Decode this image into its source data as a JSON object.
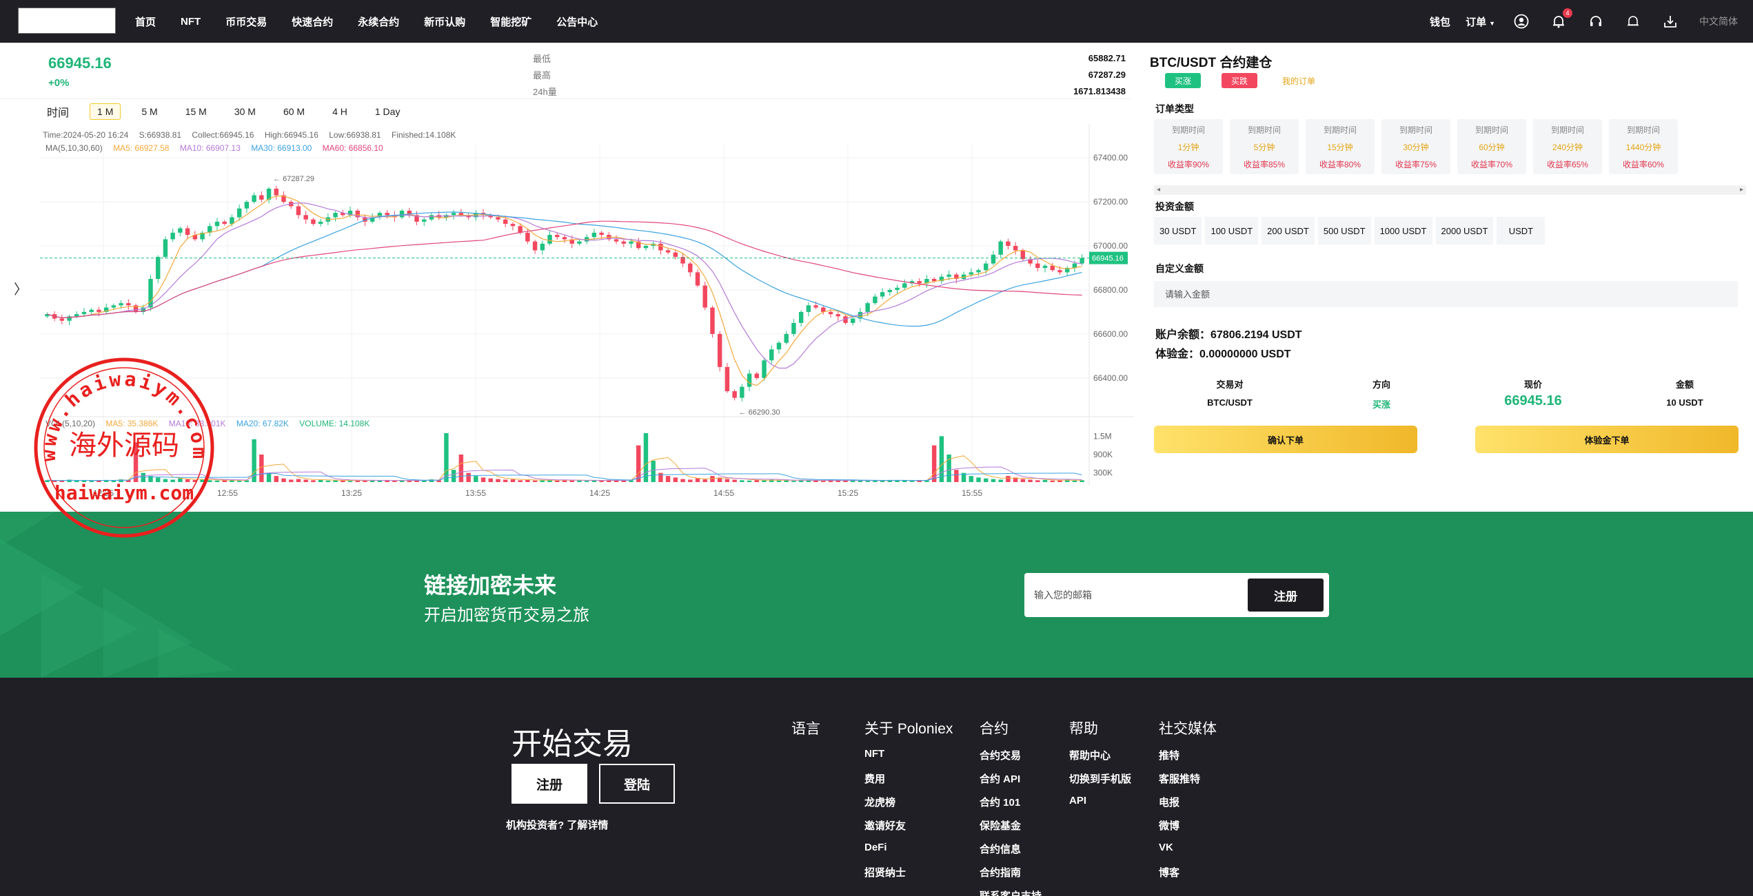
{
  "nav": {
    "links": [
      "首页",
      "NFT",
      "币币交易",
      "快速合约",
      "永续合约",
      "新币认购",
      "智能挖矿",
      "公告中心"
    ],
    "wallet": "钱包",
    "orders": "订单",
    "notification_count": "4",
    "language": "中文简体",
    "icons": [
      "user-icon",
      "bell-icon",
      "headset-icon",
      "bell-outline-icon",
      "download-icon"
    ]
  },
  "price_header": {
    "price": "66945.16",
    "change": "+0%",
    "stats": [
      {
        "label": "最低",
        "value": "65882.71"
      },
      {
        "label": "最高",
        "value": "67287.29"
      },
      {
        "label": "24h量",
        "value": "1671.813438"
      }
    ]
  },
  "periods": {
    "label": "时间",
    "items": [
      "1 M",
      "5 M",
      "15 M",
      "30 M",
      "60 M",
      "4 H",
      "1 Day"
    ],
    "active": "1 M"
  },
  "chart_data": {
    "type": "candlestick",
    "info_line": {
      "time": "Time:2024-05-20 16:24",
      "open": "S:66938.81",
      "collect": "Collect:66945.16",
      "high": "High:66945.16",
      "low": "Low:66938.81",
      "finished": "Finished:14.108K"
    },
    "ma_legend": {
      "label": "MA(5,10,30,60)",
      "ma5": "MA5: 66927.58",
      "ma10": "MA10: 66907.13",
      "ma30": "MA30: 66913.00",
      "ma60": "MA60: 66856.10"
    },
    "vol_legend": {
      "label": "VOL(5,10,20)",
      "ma5": "MA5: 35.386K",
      "ma10": "MA10: 33.901K",
      "ma20": "MA20: 67.82K",
      "volume": "VOLUME: 14.108K"
    },
    "y_ticks": [
      "67400.00",
      "67200.00",
      "67000.00",
      "66800.00",
      "66600.00",
      "66400.00"
    ],
    "y_tick_values": [
      67400,
      67200,
      67000,
      66800,
      66600,
      66400
    ],
    "vol_ticks": [
      "1.5M",
      "900K",
      "300K"
    ],
    "vol_tick_values": [
      1500000,
      900000,
      300000
    ],
    "x_ticks": [
      "12:25",
      "12:55",
      "13:25",
      "13:55",
      "14:25",
      "14:55",
      "15:25",
      "15:55"
    ],
    "current_price": "66945.16",
    "current_price_value": 66945.16,
    "max_label": "67287.29",
    "max_value": 67287.29,
    "min_label": "66290.30",
    "min_value": 66290.3,
    "closes": [
      66690,
      66670,
      66660,
      66680,
      66690,
      66700,
      66710,
      66700,
      66720,
      66730,
      66740,
      66730,
      66700,
      66720,
      66850,
      66950,
      67030,
      67060,
      67080,
      67050,
      67030,
      67060,
      67090,
      67110,
      67100,
      67130,
      67170,
      67200,
      67230,
      67210,
      67260,
      67230,
      67200,
      67180,
      67140,
      67120,
      67100,
      67110,
      67130,
      67150,
      67140,
      67160,
      67130,
      67110,
      67130,
      67150,
      67140,
      67130,
      67160,
      67140,
      67110,
      67120,
      67140,
      67130,
      67140,
      67150,
      67140,
      67130,
      67150,
      67140,
      67130,
      67120,
      67100,
      67090,
      67060,
      67020,
      66980,
      67010,
      67050,
      67040,
      67030,
      67010,
      67020,
      67040,
      67060,
      67050,
      67030,
      67020,
      67010,
      67020,
      66990,
      67000,
      67010,
      66980,
      66970,
      66950,
      66920,
      66880,
      66820,
      66720,
      66600,
      66450,
      66340,
      66310,
      66360,
      66420,
      66400,
      66480,
      66530,
      66560,
      66600,
      66650,
      66700,
      66730,
      66720,
      66700,
      66690,
      66680,
      66650,
      66670,
      66700,
      66740,
      66770,
      66790,
      66800,
      66810,
      66830,
      66840,
      66830,
      66850,
      66840,
      66860,
      66870,
      66850,
      66870,
      66880,
      66890,
      66920,
      66960,
      67020,
      67000,
      66980,
      66940,
      66920,
      66900,
      66910,
      66890,
      66880,
      66900,
      66920,
      66945
    ],
    "volumes": [
      60000,
      50000,
      40000,
      80000,
      50000,
      60000,
      40000,
      50000,
      70000,
      60000,
      90000,
      70000,
      1300000,
      300000,
      200000,
      150000,
      100000,
      80000,
      120000,
      90000,
      70000,
      80000,
      60000,
      50000,
      70000,
      60000,
      40000,
      60000,
      1400000,
      900000,
      300000,
      200000,
      120000,
      80000,
      100000,
      80000,
      60000,
      70000,
      50000,
      60000,
      50000,
      40000,
      60000,
      50000,
      70000,
      60000,
      50000,
      40000,
      60000,
      50000,
      70000,
      60000,
      90000,
      60000,
      1600000,
      400000,
      900000,
      300000,
      200000,
      150000,
      120000,
      100000,
      80000,
      90000,
      60000,
      70000,
      50000,
      60000,
      70000,
      50000,
      80000,
      60000,
      50000,
      40000,
      60000,
      50000,
      70000,
      60000,
      50000,
      60000,
      1200000,
      1600000,
      700000,
      300000,
      200000,
      150000,
      100000,
      80000,
      120000,
      90000,
      200000,
      150000,
      100000,
      80000,
      60000,
      50000,
      70000,
      60000,
      80000,
      50000,
      60000,
      40000,
      70000,
      60000,
      50000,
      40000,
      60000,
      50000,
      70000,
      60000,
      50000,
      40000,
      60000,
      50000,
      70000,
      60000,
      50000,
      40000,
      60000,
      50000,
      1200000,
      1500000,
      900000,
      400000,
      300000,
      200000,
      150000,
      120000,
      100000,
      80000,
      200000,
      150000,
      100000,
      80000,
      60000,
      70000,
      50000,
      60000,
      80000,
      50000,
      60000
    ]
  },
  "trade_panel": {
    "title": "BTC/USDT 合约建仓",
    "tabs": {
      "buy": "买涨",
      "sell": "买跌",
      "orders": "我的订单"
    },
    "order_type_label": "订单类型",
    "periods": [
      {
        "a": "到期时间",
        "b": "1分钟",
        "c": "收益率90%"
      },
      {
        "a": "到期时间",
        "b": "5分钟",
        "c": "收益率85%"
      },
      {
        "a": "到期时间",
        "b": "15分钟",
        "c": "收益率80%"
      },
      {
        "a": "到期时间",
        "b": "30分钟",
        "c": "收益率75%"
      },
      {
        "a": "到期时间",
        "b": "60分钟",
        "c": "收益率70%"
      },
      {
        "a": "到期时间",
        "b": "240分钟",
        "c": "收益率65%"
      },
      {
        "a": "到期时间",
        "b": "1440分钟",
        "c": "收益率60%"
      }
    ],
    "amount_label": "投资金额",
    "amounts": [
      "30 USDT",
      "100 USDT",
      "200 USDT",
      "500 USDT",
      "1000 USDT",
      "2000 USDT",
      "USDT"
    ],
    "custom_label": "自定义金额",
    "custom_placeholder": "请输入金额",
    "balance": "账户余额：67806.2194 USDT",
    "trial": "体验金：0.00000000 USDT",
    "summary": {
      "headers": [
        "交易对",
        "方向",
        "现价",
        "金额"
      ],
      "pair": "BTC/USDT",
      "direction": "买涨",
      "price": "66945.16",
      "amount": "10 USDT"
    },
    "confirm": "确认下单",
    "trial_order": "体验金下单"
  },
  "banner": {
    "title": "链接加密未来",
    "subtitle": "开启加密货币交易之旅",
    "email_placeholder": "输入您的邮箱",
    "register": "注册"
  },
  "footer": {
    "start": "开始交易",
    "register": "注册",
    "login": "登陆",
    "institutional": "机构投资者? 了解详情",
    "columns": [
      {
        "title": "语言",
        "items": []
      },
      {
        "title": "关于 Poloniex",
        "items": [
          "NFT",
          "费用",
          "龙虎榜",
          "邀请好友",
          "DeFi",
          "招贤纳士"
        ]
      },
      {
        "title": "合约",
        "items": [
          "合约交易",
          "合约 API",
          "合约 101",
          "保险基金",
          "合约信息",
          "合约指南",
          "联系客户支持"
        ]
      },
      {
        "title": "帮助",
        "items": [
          "帮助中心",
          "切换到手机版",
          "API"
        ]
      },
      {
        "title": "社交媒体",
        "items": [
          "推特",
          "客服推特",
          "电报",
          "微博",
          "VK",
          "博客"
        ]
      }
    ]
  },
  "watermark": {
    "top_text": "www.haiwaiym.com",
    "center_text": "海外源码",
    "bottom_text": "haiwaiym.com",
    "color": "#e8201e"
  },
  "colors": {
    "up": "#1fc181",
    "down": "#f2475e",
    "ma5": "#f3a93a",
    "ma10": "#b57ad8",
    "ma30": "#3aa2e0",
    "ma60": "#e0457b"
  }
}
